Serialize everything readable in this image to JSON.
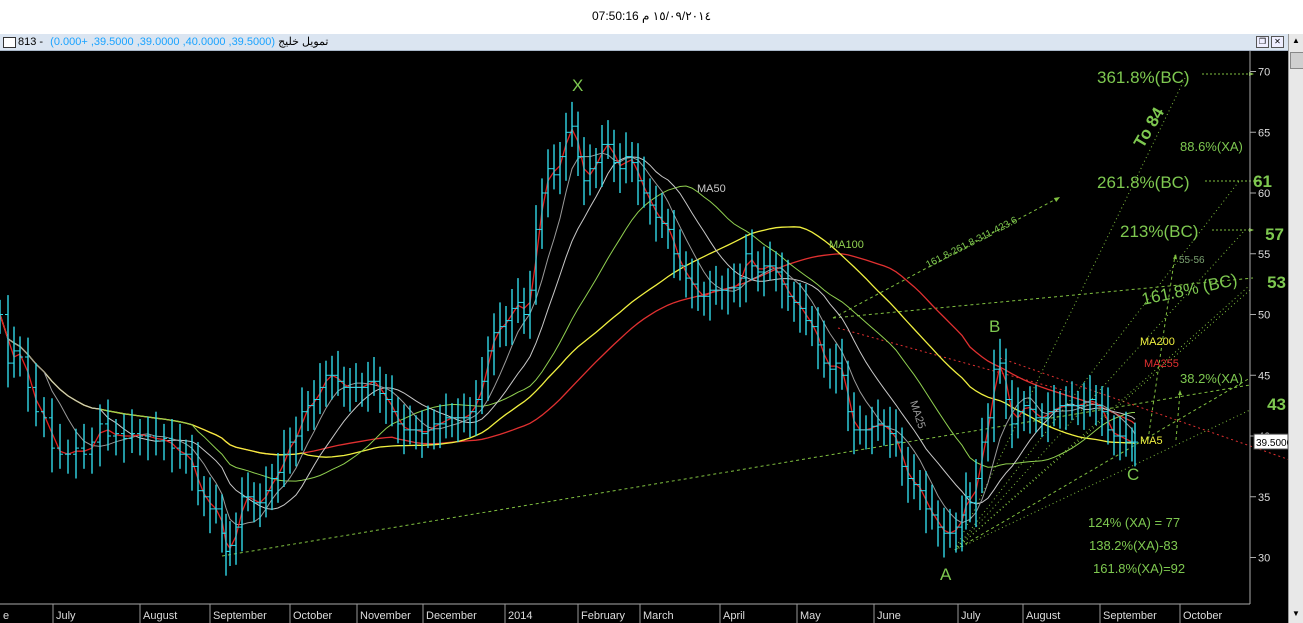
{
  "header": {
    "clock": "07:50:16 ١٥/٠٩/٢٠١٤ م"
  },
  "window": {
    "name": "813 - تمويل خليج",
    "ohlc": "(39.5000, 40.0000, 39.0000, 39.5000, +0.000)"
  },
  "chart_data": {
    "type": "line",
    "title": "",
    "y_ticks": [
      30,
      35,
      40,
      45,
      50,
      55,
      60,
      65,
      70
    ],
    "ylim": [
      27.5,
      72.2
    ],
    "x_tick_labels": [
      "e",
      "July",
      "August",
      "September",
      "October",
      "November",
      "December",
      "2014",
      "February",
      "March",
      "April",
      "May",
      "June",
      "July",
      "August",
      "September",
      "October"
    ],
    "last_price": "39.5000",
    "price": [
      [
        0,
        50
      ],
      [
        8,
        46
      ],
      [
        14,
        47
      ],
      [
        20,
        46.5
      ],
      [
        28,
        44
      ],
      [
        36,
        42
      ],
      [
        44,
        41.5
      ],
      [
        52,
        39
      ],
      [
        60,
        38.5
      ],
      [
        68,
        38.5
      ],
      [
        76,
        39
      ],
      [
        84,
        38.5
      ],
      [
        92,
        39.5
      ],
      [
        100,
        41
      ],
      [
        108,
        40
      ],
      [
        116,
        40.2
      ],
      [
        124,
        39.8
      ],
      [
        132,
        40.2
      ],
      [
        140,
        40
      ],
      [
        148,
        40
      ],
      [
        156,
        39.6
      ],
      [
        164,
        39.8
      ],
      [
        172,
        39
      ],
      [
        180,
        38.5
      ],
      [
        186,
        38.5
      ],
      [
        192,
        37.5
      ],
      [
        198,
        35.5
      ],
      [
        204,
        35
      ],
      [
        210,
        34
      ],
      [
        216,
        34
      ],
      [
        222,
        32
      ],
      [
        226,
        30.5
      ],
      [
        230,
        31
      ],
      [
        236,
        32.5
      ],
      [
        242,
        35
      ],
      [
        248,
        35
      ],
      [
        254,
        34.5
      ],
      [
        260,
        34.5
      ],
      [
        266,
        35.5
      ],
      [
        272,
        36.5
      ],
      [
        278,
        37
      ],
      [
        284,
        38.5
      ],
      [
        290,
        39.5
      ],
      [
        296,
        40
      ],
      [
        302,
        42
      ],
      [
        308,
        42.5
      ],
      [
        314,
        43
      ],
      [
        320,
        44
      ],
      [
        326,
        45
      ],
      [
        332,
        45
      ],
      [
        338,
        44.5
      ],
      [
        344,
        44
      ],
      [
        350,
        44
      ],
      [
        356,
        44
      ],
      [
        362,
        44
      ],
      [
        368,
        44.5
      ],
      [
        374,
        44.5
      ],
      [
        380,
        43.5
      ],
      [
        386,
        43
      ],
      [
        392,
        42
      ],
      [
        398,
        41
      ],
      [
        404,
        40.5
      ],
      [
        410,
        40.5
      ],
      [
        416,
        40.5
      ],
      [
        422,
        40.2
      ],
      [
        428,
        40.5
      ],
      [
        434,
        41
      ],
      [
        440,
        41
      ],
      [
        446,
        41.5
      ],
      [
        452,
        41.5
      ],
      [
        458,
        41.5
      ],
      [
        464,
        41.5
      ],
      [
        470,
        42
      ],
      [
        476,
        43
      ],
      [
        482,
        44.5
      ],
      [
        488,
        47
      ],
      [
        494,
        48.5
      ],
      [
        500,
        49
      ],
      [
        506,
        49.5
      ],
      [
        512,
        50.5
      ],
      [
        518,
        51
      ],
      [
        524,
        50
      ],
      [
        530,
        52
      ],
      [
        536,
        57
      ],
      [
        542,
        60
      ],
      [
        548,
        62
      ],
      [
        554,
        61.5
      ],
      [
        560,
        63
      ],
      [
        566,
        65
      ],
      [
        572,
        65.5
      ],
      [
        578,
        63
      ],
      [
        584,
        61
      ],
      [
        590,
        62
      ],
      [
        596,
        62.5
      ],
      [
        602,
        64
      ],
      [
        608,
        64
      ],
      [
        614,
        62.5
      ],
      [
        620,
        62
      ],
      [
        626,
        63
      ],
      [
        632,
        62.5
      ],
      [
        638,
        61
      ],
      [
        644,
        60
      ],
      [
        650,
        59
      ],
      [
        656,
        58
      ],
      [
        662,
        57.5
      ],
      [
        668,
        57
      ],
      [
        674,
        55
      ],
      [
        680,
        54
      ],
      [
        686,
        53
      ],
      [
        692,
        52.5
      ],
      [
        698,
        51.5
      ],
      [
        704,
        51.5
      ],
      [
        710,
        52
      ],
      [
        716,
        52
      ],
      [
        722,
        52
      ],
      [
        728,
        52.2
      ],
      [
        734,
        52.2
      ],
      [
        740,
        53
      ],
      [
        746,
        55
      ],
      [
        752,
        54
      ],
      [
        758,
        53.5
      ],
      [
        764,
        54
      ],
      [
        770,
        54
      ],
      [
        776,
        53.5
      ],
      [
        782,
        52.5
      ],
      [
        788,
        51.5
      ],
      [
        794,
        51
      ],
      [
        800,
        50.5
      ],
      [
        806,
        49.5
      ],
      [
        812,
        49
      ],
      [
        818,
        47.5
      ],
      [
        824,
        46
      ],
      [
        830,
        45.5
      ],
      [
        836,
        46
      ],
      [
        842,
        45
      ],
      [
        848,
        42
      ],
      [
        854,
        40.5
      ],
      [
        860,
        40.5
      ],
      [
        866,
        40.5
      ],
      [
        872,
        40.8
      ],
      [
        878,
        41
      ],
      [
        884,
        40.8
      ],
      [
        890,
        40.2
      ],
      [
        896,
        39.5
      ],
      [
        902,
        37.5
      ],
      [
        908,
        36.5
      ],
      [
        914,
        36
      ],
      [
        920,
        35.5
      ],
      [
        926,
        34
      ],
      [
        932,
        33.5
      ],
      [
        938,
        32.5
      ],
      [
        944,
        32
      ],
      [
        950,
        32
      ],
      [
        956,
        32.5
      ],
      [
        962,
        33.5
      ],
      [
        966,
        35
      ],
      [
        970,
        34.5
      ],
      [
        976,
        36.5
      ],
      [
        982,
        39.5
      ],
      [
        988,
        41.5
      ],
      [
        994,
        45.5
      ],
      [
        1000,
        46
      ],
      [
        1006,
        43
      ],
      [
        1012,
        41
      ],
      [
        1018,
        42
      ],
      [
        1024,
        42.5
      ],
      [
        1030,
        42.2
      ],
      [
        1036,
        41.5
      ],
      [
        1042,
        41.5
      ],
      [
        1048,
        42
      ],
      [
        1054,
        42.2
      ],
      [
        1060,
        42.5
      ],
      [
        1066,
        42.5
      ],
      [
        1072,
        42.5
      ],
      [
        1078,
        42.5
      ],
      [
        1084,
        42.8
      ],
      [
        1090,
        43
      ],
      [
        1096,
        42.5
      ],
      [
        1102,
        42
      ],
      [
        1108,
        40.5
      ],
      [
        1114,
        40
      ],
      [
        1120,
        40
      ],
      [
        1126,
        39.5
      ],
      [
        1132,
        39.5
      ],
      [
        1135,
        39.5
      ]
    ],
    "overlays": [
      {
        "label": "MA5"
      },
      {
        "label": "MA25"
      },
      {
        "label": "MA50"
      },
      {
        "label": "MA100"
      },
      {
        "label": "MA200"
      },
      {
        "label": "MA255"
      }
    ],
    "annotations": {
      "wave": [
        "X",
        "A",
        "B",
        "C"
      ],
      "fib_left": [
        "361.8%(BC)",
        "88.6%(XA)",
        "261.8%(BC)",
        "213%(BC)",
        "161.8% (BC)",
        "38.2%(XA)"
      ],
      "targets": [
        "61",
        "57",
        "53",
        "43"
      ],
      "to84": "To 84",
      "proj": "161.8-261.8-311-423.6",
      "n5556": "55-56",
      "bottom": [
        "124% (XA) = 77",
        "138.2%(XA)-83",
        "161.8%(XA)=92"
      ]
    },
    "colors": {
      "background": "#000000",
      "price": "#30d8e8",
      "ma5": "#e02020",
      "ma25": "#9a9a9a",
      "ma50": "#c8c8c8",
      "ma100": "#90d050",
      "ma200": "#f0f040",
      "ma255": "#e03030",
      "fib": "#7ec850",
      "trend": "#80c040"
    }
  }
}
